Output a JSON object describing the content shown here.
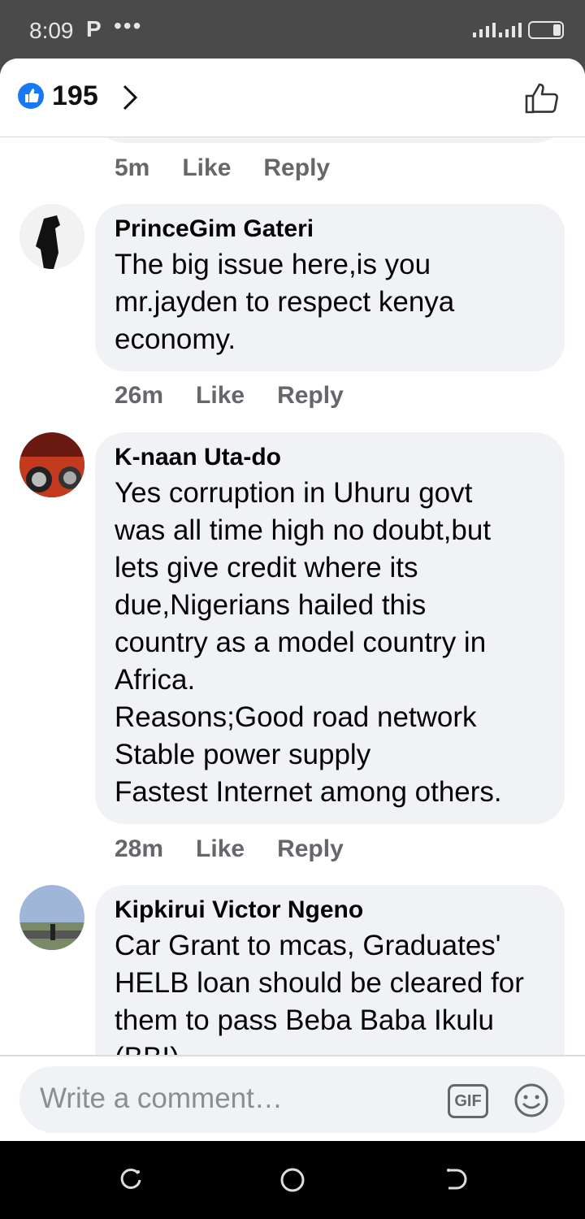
{
  "status_bar": {
    "time": "8:09",
    "app_icon": "P",
    "dots": "•••"
  },
  "header": {
    "like_count": "195",
    "like_icon": "thumbs-up-icon",
    "accent": "#1877f2"
  },
  "prev_meta": {
    "time": "5m",
    "like": "Like",
    "reply": "Reply"
  },
  "comments": [
    {
      "author": "PrinceGim Gateri",
      "text": "The big issue here,is you\nmr.jayden to respect kenya\neconomy.",
      "time": "26m",
      "like": "Like",
      "reply": "Reply"
    },
    {
      "author": "K-naan Uta-do",
      "text": "Yes corruption in Uhuru govt\nwas all time high no doubt,but\nlets give credit where its\ndue,Nigerians hailed this\ncountry as a model country in\nAfrica.\nReasons;Good road network\nStable power supply\nFastest Internet among others.",
      "time": "28m",
      "like": "Like",
      "reply": "Reply"
    },
    {
      "author": "Kipkirui Victor Ngeno",
      "text": "Car Grant to mcas, Graduates'\nHELB loan should be cleared for\nthem to pass Beba Baba Ikulu\n(BBI)"
    }
  ],
  "composer": {
    "placeholder": "Write a comment…",
    "gif_label": "GIF"
  }
}
